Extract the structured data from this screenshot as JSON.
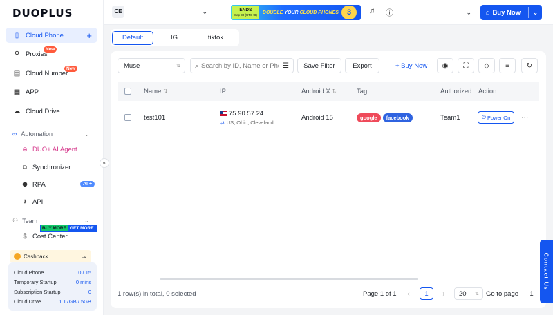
{
  "brand": "DUOPLUS",
  "sidebar": {
    "items": [
      {
        "label": "Cloud Phone",
        "icon": "phone-icon"
      },
      {
        "label": "Proxies",
        "icon": "network-icon",
        "badge": "New"
      },
      {
        "label": "Cloud Number",
        "icon": "sim-icon",
        "badge": "New"
      },
      {
        "label": "APP",
        "icon": "grid-icon"
      },
      {
        "label": "Cloud Drive",
        "icon": "cloud-icon"
      }
    ],
    "automation": {
      "label": "Automation",
      "items": [
        {
          "label": "DUO+ AI Agent"
        },
        {
          "label": "Synchronizer"
        },
        {
          "label": "RPA",
          "badge": "AI +"
        },
        {
          "label": "API"
        }
      ]
    },
    "team": {
      "label": "Team",
      "promo_left": "BUY MORE",
      "promo_right": "GET MORE",
      "items": [
        {
          "label": "Cost Center"
        }
      ]
    },
    "cashback": "Cashback",
    "usage": [
      {
        "label": "Cloud Phone",
        "value": "0 / 15"
      },
      {
        "label": "Temporary Startup",
        "value": "0 mins"
      },
      {
        "label": "Subscription Startup",
        "value": "0"
      },
      {
        "label": "Cloud Drive",
        "value": "1.17GB / 5GB"
      }
    ]
  },
  "topbar": {
    "workspace": "CE",
    "promo_ends": "ENDS",
    "promo_ends_date": "Sep 30 (UTC+8)",
    "promo_text_a": "DOUBLE",
    "promo_text_b": "YOUR",
    "promo_text_c": "CLOUD PHONES",
    "promo_days": "3",
    "buy_now": "Buy Now"
  },
  "tabs": [
    {
      "label": "Default",
      "selected": true
    },
    {
      "label": "IG",
      "selected": false
    },
    {
      "label": "tiktok",
      "selected": false
    }
  ],
  "toolbar": {
    "group_select": "Muse",
    "search_placeholder": "Search by ID, Name or Phone",
    "save_filter": "Save Filter",
    "export": "Export",
    "buy_now": "+ Buy Now"
  },
  "table": {
    "columns": [
      "Name",
      "IP",
      "Android X",
      "Tag",
      "Authorized",
      "Action"
    ],
    "rows": [
      {
        "name": "test101",
        "ip": "75.90.57.24",
        "location": "US, Ohio, Cleveland",
        "android": "Android 15",
        "tags": [
          {
            "label": "google",
            "color": "#ef4a5a"
          },
          {
            "label": "facebook",
            "color": "#2f63e0"
          }
        ],
        "authorized": "Team1",
        "action": "Power On"
      }
    ]
  },
  "footer": {
    "summary": "1 row(s) in total, 0 selected",
    "page_info": "Page 1 of 1",
    "current_page": "1",
    "page_size": "20",
    "goto_label": "Go to page",
    "goto_value": "1"
  },
  "contact": "Contact Us",
  "colors": {
    "accent": "#1456f0",
    "badge_new": "#ff5a3c"
  }
}
